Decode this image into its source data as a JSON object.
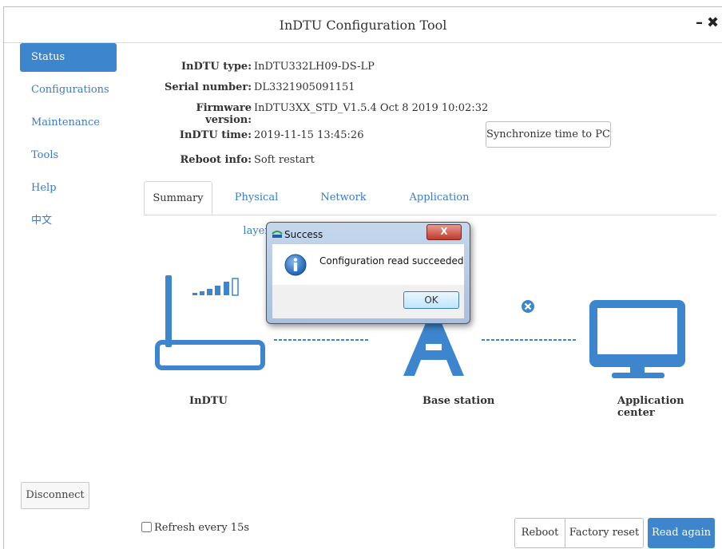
{
  "window": {
    "title": "InDTU Configuration Tool",
    "minimize_glyph": "–",
    "close_glyph": "✖"
  },
  "sidebar": {
    "items": [
      {
        "label": "Status",
        "active": true
      },
      {
        "label": "Configurations"
      },
      {
        "label": "Maintenance"
      },
      {
        "label": "Tools"
      },
      {
        "label": "Help"
      },
      {
        "label": "中文"
      }
    ],
    "disconnect": "Disconnect"
  },
  "info": {
    "type_label": "InDTU type:",
    "type_value": "InDTU332LH09-DS-LP",
    "serial_label": "Serial number:",
    "serial_value": "DL3321905091151",
    "firmware_label": "Firmware version:",
    "firmware_value": "InDTU3XX_STD_V1.5.4 Oct 8 2019 10:02:32",
    "time_label": "InDTU time:",
    "time_value": "2019-11-15 13:45:26",
    "reboot_label": "Reboot info:",
    "reboot_value": "Soft restart",
    "sync_button": "Synchronize time to PC"
  },
  "tabs": [
    {
      "label": "Summary",
      "active": true
    },
    {
      "label": "Physical layer"
    },
    {
      "label": "Network layer"
    },
    {
      "label": "Application layer"
    }
  ],
  "diagram": {
    "nodes": {
      "dtu": "InDTU",
      "base": "Base station",
      "center": "Application center"
    },
    "accent": "#3d86cd"
  },
  "footer": {
    "refresh_label": "Refresh every 15s",
    "reboot": "Reboot",
    "factory_reset": "Factory reset",
    "read_again": "Read again"
  },
  "dialog": {
    "title": "Success",
    "message": "Configuration read succeeded",
    "ok": "OK",
    "close_glyph": "X"
  }
}
